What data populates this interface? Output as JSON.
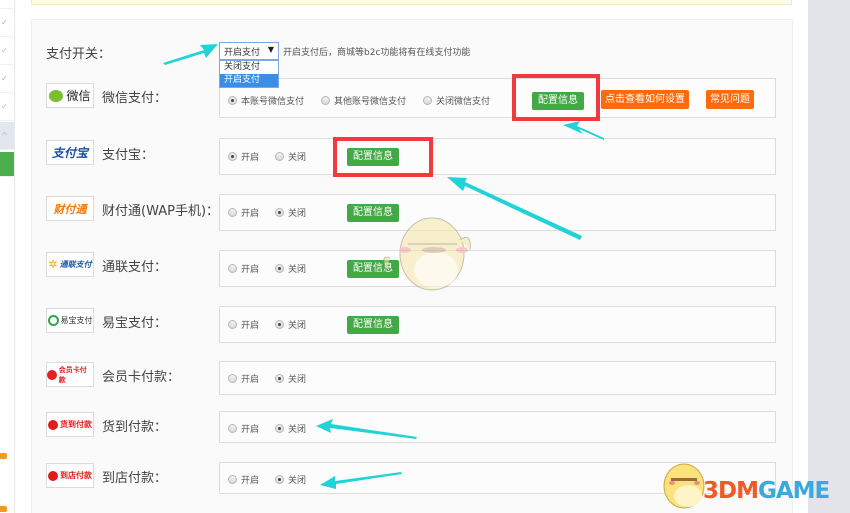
{
  "sidebar": {
    "items": [
      {
        "icon": "check-icon",
        "state": "normal"
      },
      {
        "icon": "check-icon",
        "state": "normal"
      },
      {
        "icon": "check-icon",
        "state": "normal"
      },
      {
        "icon": "check-icon",
        "state": "normal"
      },
      {
        "icon": "chevron-up-icon",
        "state": "hover"
      },
      {
        "icon": "",
        "state": "active"
      }
    ],
    "badge_count": 2
  },
  "payment_switch": {
    "label": "支付开关：",
    "selected": "开启支付",
    "options": [
      "关闭支付",
      "开启支付"
    ],
    "hint": "开启支付后，商城等b2c功能将有在线支付功能"
  },
  "config_label": "配置信息",
  "methods": [
    {
      "id": "wechat",
      "logo_text": "微信",
      "label": "微信支付：",
      "options": [
        "本账号微信支付",
        "其他账号微信支付",
        "关闭微信支付"
      ],
      "selected": 0,
      "has_config": true,
      "extra_buttons": [
        "点击查看如何设置",
        "常见问题"
      ]
    },
    {
      "id": "alipay",
      "logo_text": "支付宝",
      "label": "支付宝：",
      "options": [
        "开启",
        "关闭"
      ],
      "selected": 0,
      "has_config": true
    },
    {
      "id": "tenpay",
      "logo_text": "财付通",
      "label": "财付通(WAP手机)：",
      "options": [
        "开启",
        "关闭"
      ],
      "selected": 1,
      "has_config": true
    },
    {
      "id": "allinpay",
      "logo_text": "通联支付",
      "label": "通联支付：",
      "options": [
        "开启",
        "关闭"
      ],
      "selected": 1,
      "has_config": true
    },
    {
      "id": "yeepay",
      "logo_text": "易宝支付",
      "label": "易宝支付：",
      "options": [
        "开启",
        "关闭"
      ],
      "selected": 1,
      "has_config": true
    },
    {
      "id": "membercard",
      "logo_text": "会员卡付款",
      "label": "会员卡付款：",
      "options": [
        "开启",
        "关闭"
      ],
      "selected": 1,
      "has_config": false
    },
    {
      "id": "cod",
      "logo_text": "货到付款",
      "label": "货到付款：",
      "options": [
        "开启",
        "关闭"
      ],
      "selected": 1,
      "has_config": false
    },
    {
      "id": "instore",
      "logo_text": "到店付款",
      "label": "到店付款：",
      "options": [
        "开启",
        "关闭"
      ],
      "selected": 1,
      "has_config": false
    }
  ],
  "colors": {
    "config_button": "#43a845",
    "help_button": "#ff6a0c",
    "highlight": "#f3393e",
    "annotation_arrow": "#1fd3d6"
  },
  "watermark": {
    "part1": "3DM",
    "part2": "GAME"
  }
}
